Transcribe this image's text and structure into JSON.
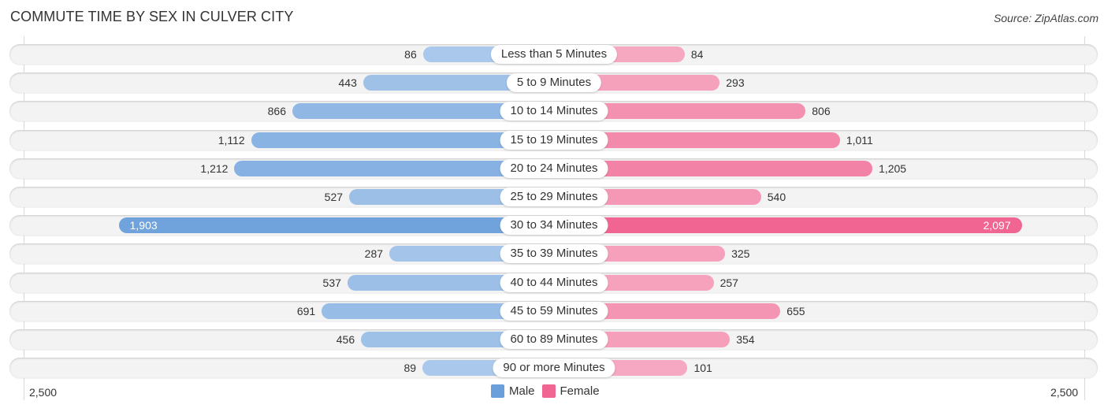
{
  "title": "COMMUTE TIME BY SEX IN CULVER CITY",
  "source": "Source: ZipAtlas.com",
  "chart_data": {
    "type": "bar",
    "orientation": "horizontal-diverging",
    "title": "COMMUTE TIME BY SEX IN CULVER CITY",
    "categories": [
      "Less than 5 Minutes",
      "5 to 9 Minutes",
      "10 to 14 Minutes",
      "15 to 19 Minutes",
      "20 to 24 Minutes",
      "25 to 29 Minutes",
      "30 to 34 Minutes",
      "35 to 39 Minutes",
      "40 to 44 Minutes",
      "45 to 59 Minutes",
      "60 to 89 Minutes",
      "90 or more Minutes"
    ],
    "series": [
      {
        "name": "Male",
        "color": "#6a9fdb",
        "values": [
          86,
          443,
          866,
          1112,
          1212,
          527,
          1903,
          287,
          537,
          691,
          456,
          89
        ],
        "labels": [
          "86",
          "443",
          "866",
          "1,112",
          "1,212",
          "527",
          "1,903",
          "287",
          "537",
          "691",
          "456",
          "89"
        ]
      },
      {
        "name": "Female",
        "color": "#f06592",
        "values": [
          84,
          293,
          806,
          1011,
          1205,
          540,
          2097,
          325,
          257,
          655,
          354,
          101
        ],
        "labels": [
          "84",
          "293",
          "806",
          "1,011",
          "1,205",
          "540",
          "2,097",
          "325",
          "257",
          "655",
          "354",
          "101"
        ]
      }
    ],
    "axis": {
      "min_label": "2,500",
      "max_label": "2,500",
      "range": [
        -2500,
        2500
      ]
    },
    "legend": {
      "position": "bottom-center",
      "items": [
        "Male",
        "Female"
      ]
    },
    "grid": false
  }
}
